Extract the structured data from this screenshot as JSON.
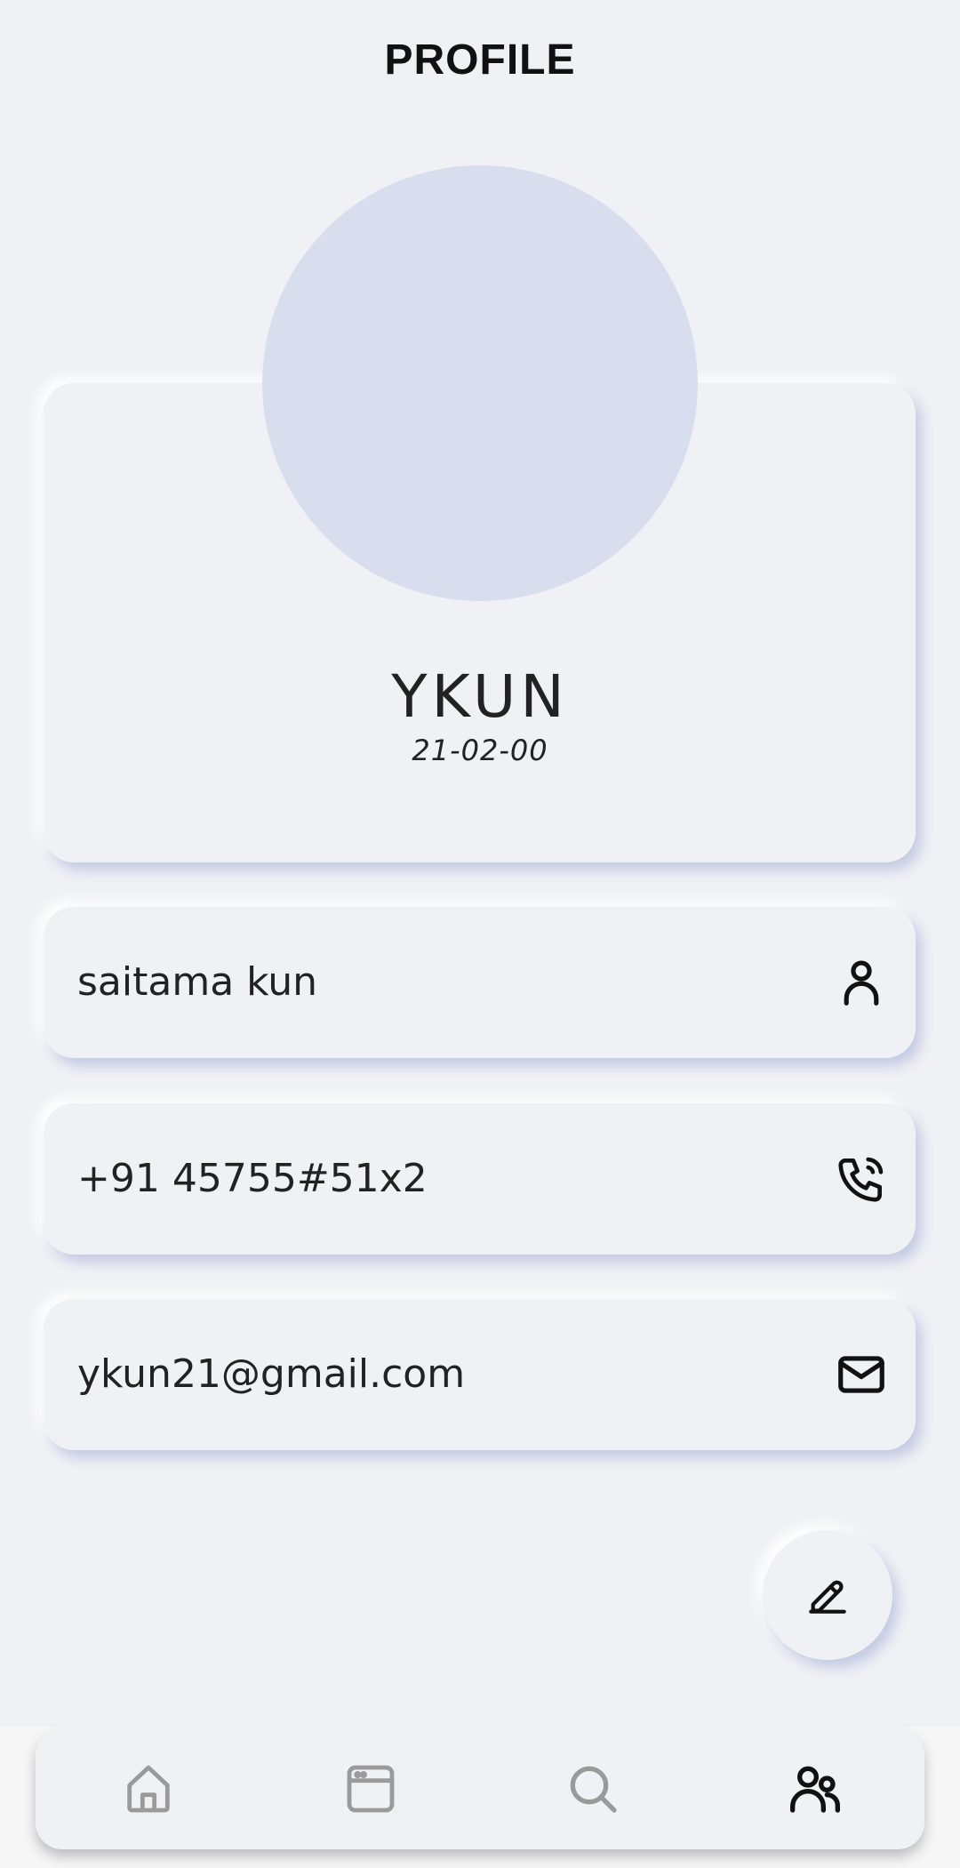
{
  "header": {
    "title": "PROFILE"
  },
  "profile": {
    "name": "YKUN",
    "date": "21-02-00"
  },
  "info": {
    "username": "saitama kun",
    "username_icon": "person-icon",
    "phone": "+91 45755#51x2",
    "phone_icon": "phone-icon",
    "email": "ykun21@gmail.com",
    "email_icon": "mail-icon"
  },
  "fab": {
    "icon": "edit-icon"
  },
  "bottom_nav": {
    "items": [
      {
        "icon": "home-icon",
        "active": false
      },
      {
        "icon": "browser-window-icon",
        "active": false
      },
      {
        "icon": "search-icon",
        "active": false
      },
      {
        "icon": "people-icon",
        "active": true
      }
    ]
  },
  "colors": {
    "background": "#f0f1f5",
    "avatar": "#d9deee",
    "text": "#222222",
    "inactive_icon": "#9a9a9a",
    "active_icon": "#111111"
  }
}
